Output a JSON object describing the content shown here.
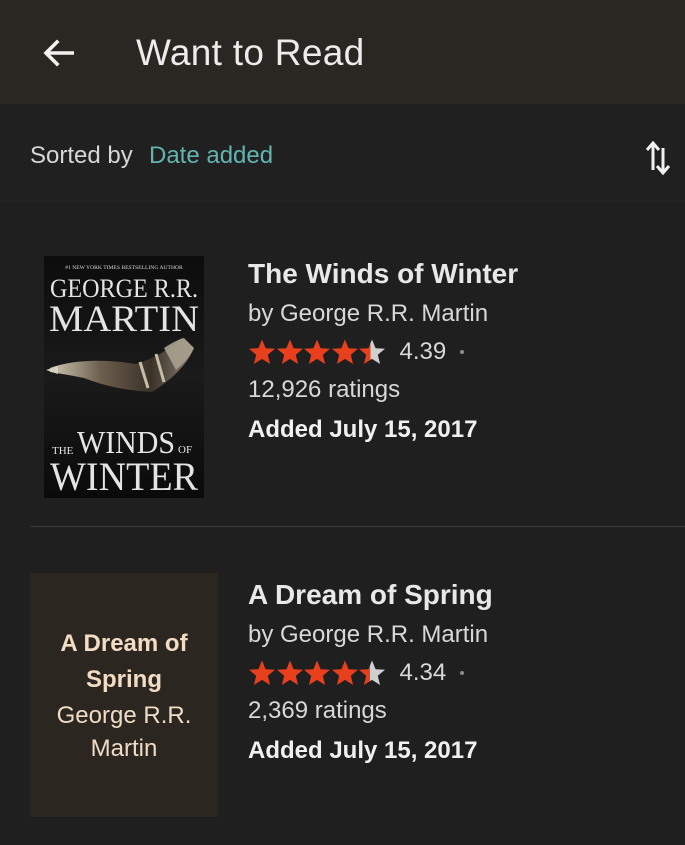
{
  "header": {
    "title": "Want to Read",
    "back_icon": "arrow-left-icon"
  },
  "sort": {
    "label": "Sorted by",
    "value": "Date added",
    "toggle_icon": "sort-swap-icon"
  },
  "colors": {
    "accent": "#62b4ae",
    "star": "#e8401c",
    "star_empty": "#cfcfcf",
    "appbar": "#2a2621",
    "background": "#1f1f1f"
  },
  "books": [
    {
      "title": "The Winds of Winter",
      "author": "by George R.R. Martin",
      "rating": "4.39",
      "rating_value": 4.39,
      "ratings_count": "12,926 ratings",
      "added": "Added July 15, 2017",
      "cover": {
        "type": "image",
        "tagline": "#1 NEW YORK TIMES BESTSELLING AUTHOR",
        "author_line1": "GEORGE R.R.",
        "author_line2": "MARTIN",
        "title_the": "THE",
        "title_winds": "WINDS",
        "title_of": "OF",
        "title_winter": "WINTER"
      }
    },
    {
      "title": "A Dream of Spring",
      "author": "by George R.R. Martin",
      "rating": "4.34",
      "rating_value": 4.34,
      "ratings_count": "2,369 ratings",
      "added": "Added July 15, 2017",
      "cover": {
        "type": "placeholder",
        "title": "A Dream of Spring",
        "author": "George R.R. Martin"
      }
    }
  ]
}
